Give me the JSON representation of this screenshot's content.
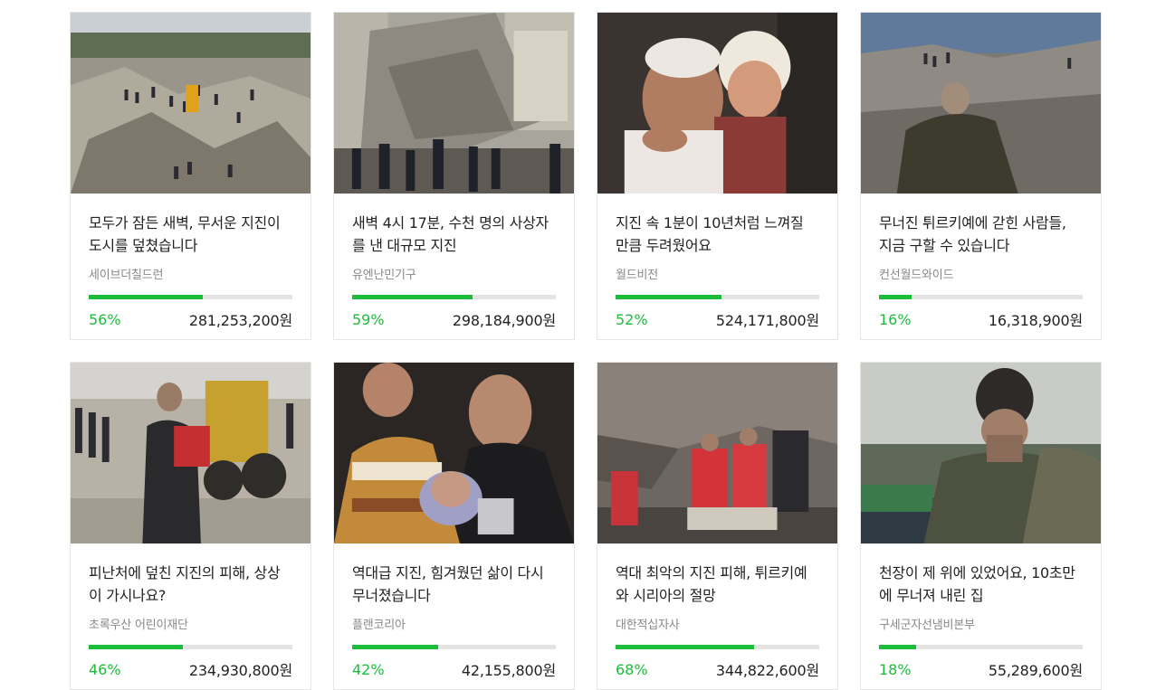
{
  "accent_color": "#1bbd3b",
  "cards": [
    {
      "title": "모두가 잠든 새벽, 무서운 지진이 도시를 덮쳤습니다",
      "org": "세이브더칠드런",
      "percent": "56%",
      "progress": 0.56,
      "amount": "281,253,200원",
      "image": "rubble-crowd-aerial"
    },
    {
      "title": "새벽 4시 17분, 수천 명의 사상자를 낸 대규모 지진",
      "org": "유엔난민기구",
      "percent": "59%",
      "progress": 0.59,
      "amount": "298,184,900원",
      "image": "collapsed-building-street"
    },
    {
      "title": "지진 속 1분이 10년처럼 느껴질 만큼 두려웠어요",
      "org": "월드비전",
      "percent": "52%",
      "progress": 0.52,
      "amount": "524,171,800원",
      "image": "father-with-injured-child"
    },
    {
      "title": "무너진 튀르키예에 갇힌 사람들, 지금 구할 수 있습니다",
      "org": "컨선월드와이드",
      "percent": "16%",
      "progress": 0.16,
      "amount": "16,318,900원",
      "image": "man-sitting-on-rubble"
    },
    {
      "title": "피난처에 덮친 지진의 피해, 상상이 가시나요?",
      "org": "초록우산 어린이재단",
      "percent": "46%",
      "progress": 0.46,
      "amount": "234,930,800원",
      "image": "man-carrying-child-bulldozer"
    },
    {
      "title": "역대급 지진, 힘겨웠던 삶이 다시 무너졌습니다",
      "org": "플랜코리아",
      "percent": "42%",
      "progress": 0.42,
      "amount": "42,155,800원",
      "image": "crying-man-with-child"
    },
    {
      "title": "역대 최악의 지진 피해, 튀르키예와 시리아의 절망",
      "org": "대한적십자사",
      "percent": "68%",
      "progress": 0.68,
      "amount": "344,822,600원",
      "image": "red-crescent-rescuers"
    },
    {
      "title": "천장이 제 위에 있었어요, 10초만에 무너져 내린 집",
      "org": "구세군자선냄비본부",
      "percent": "18%",
      "progress": 0.18,
      "amount": "55,289,600원",
      "image": "man-covering-face-hospital"
    }
  ]
}
